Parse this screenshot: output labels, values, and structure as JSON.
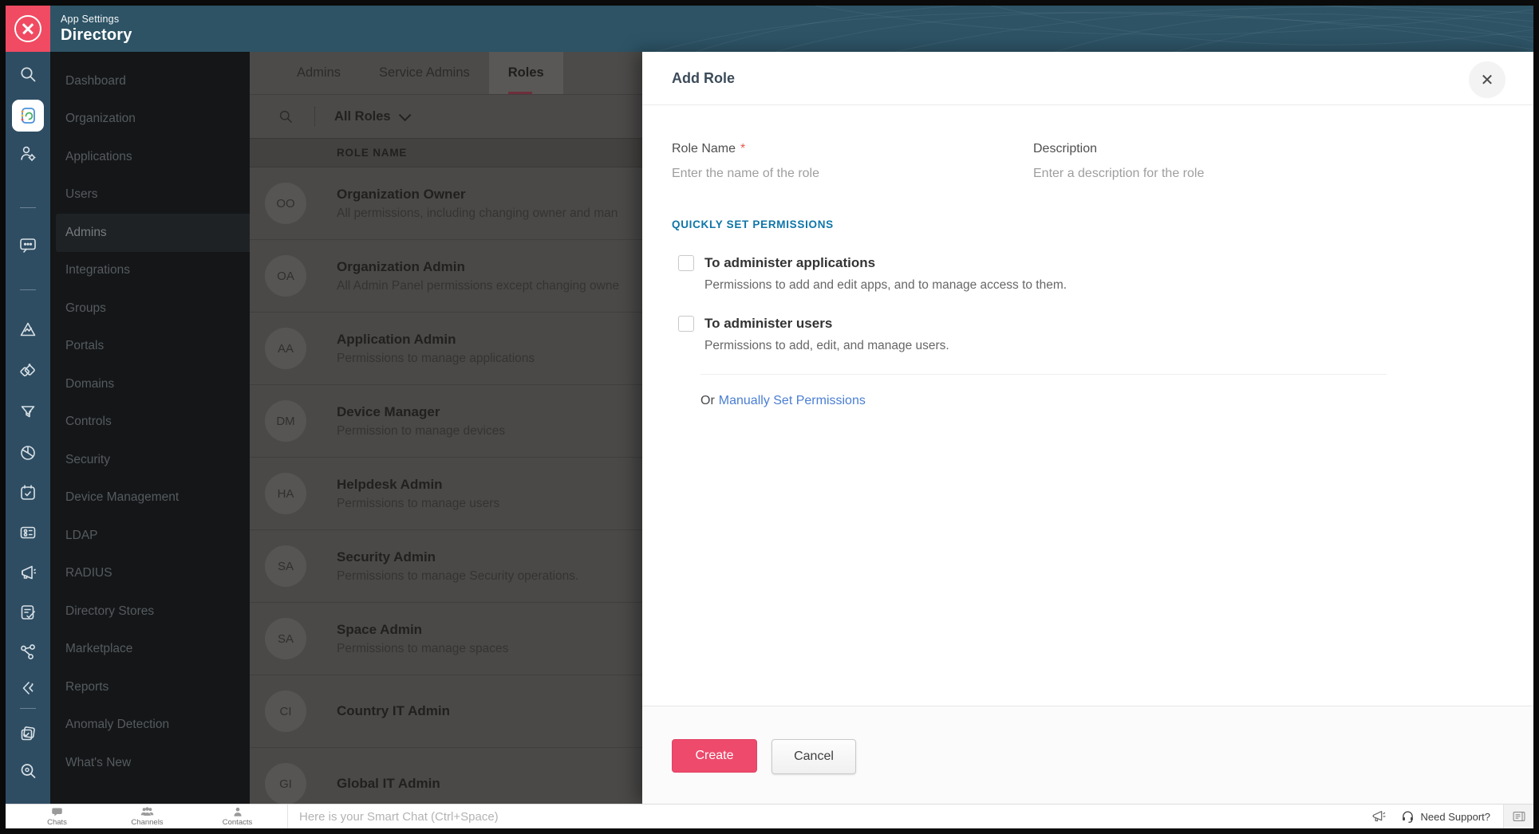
{
  "colors": {
    "accent_pink": "#ee4a6c",
    "brand_red": "#f04b62",
    "header_teal": "#2d5365",
    "rail_blue": "#2e4d63",
    "section_blue": "#0e76a8",
    "link_blue": "#4a7ed2",
    "input_focus_blue": "#2ba6e0"
  },
  "header": {
    "app_label": "App Settings",
    "title": "Directory"
  },
  "rail": {
    "icons": [
      "search",
      "directory-app",
      "admin-users",
      "chat",
      "activity",
      "shapes",
      "filter",
      "globe",
      "planner",
      "card",
      "announcement",
      "tasks",
      "connections",
      "bookmark",
      "tags",
      "explore"
    ]
  },
  "sidebar": {
    "items": [
      "Dashboard",
      "Organization",
      "Applications",
      "Users",
      "Admins",
      "Integrations",
      "Groups",
      "Portals",
      "Domains",
      "Controls",
      "Security",
      "Device Management",
      "LDAP",
      "RADIUS",
      "Directory Stores",
      "Marketplace",
      "Reports",
      "Anomaly Detection",
      "What's New"
    ],
    "active_item": "Admins"
  },
  "content": {
    "tabs": [
      "Admins",
      "Service Admins",
      "Roles"
    ],
    "active_tab": "Roles",
    "filter": {
      "label": "All Roles"
    },
    "table": {
      "header": "ROLE NAME",
      "rows": [
        {
          "initials": "OO",
          "name": "Organization Owner",
          "description": "All permissions, including changing owner and man"
        },
        {
          "initials": "OA",
          "name": "Organization Admin",
          "description": "All Admin Panel permissions except changing owne"
        },
        {
          "initials": "AA",
          "name": "Application Admin",
          "description": "Permissions to manage applications"
        },
        {
          "initials": "DM",
          "name": "Device Manager",
          "description": "Permission to manage devices"
        },
        {
          "initials": "HA",
          "name": "Helpdesk Admin",
          "description": "Permissions to manage users"
        },
        {
          "initials": "SA",
          "name": "Security Admin",
          "description": "Permissions to manage Security operations."
        },
        {
          "initials": "SA",
          "name": "Space Admin",
          "description": "Permissions to manage spaces"
        },
        {
          "initials": "CI",
          "name": "Country IT Admin",
          "description": ""
        },
        {
          "initials": "GI",
          "name": "Global IT Admin",
          "description": ""
        }
      ]
    }
  },
  "modal": {
    "title": "Add Role",
    "close_glyph": "✕",
    "fields": {
      "role_name": {
        "label": "Role Name",
        "required_mark": "*",
        "placeholder": "Enter the name of the role"
      },
      "description": {
        "label": "Description",
        "placeholder": "Enter a description for the role"
      }
    },
    "section_title": "QUICKLY SET PERMISSIONS",
    "options": [
      {
        "label": "To administer applications",
        "description": "Permissions to add and edit apps, and to manage access to them."
      },
      {
        "label": "To administer users",
        "description": "Permissions to add, edit, and manage users."
      }
    ],
    "or_text": "Or",
    "manual_link": "Manually Set Permissions",
    "create_label": "Create",
    "cancel_label": "Cancel"
  },
  "bottombar": {
    "tabs": [
      {
        "label": "Chats"
      },
      {
        "label": "Channels"
      },
      {
        "label": "Contacts"
      }
    ],
    "smart_chat_placeholder": "Here is your Smart Chat (Ctrl+Space)",
    "support_label": "Need Support?"
  }
}
